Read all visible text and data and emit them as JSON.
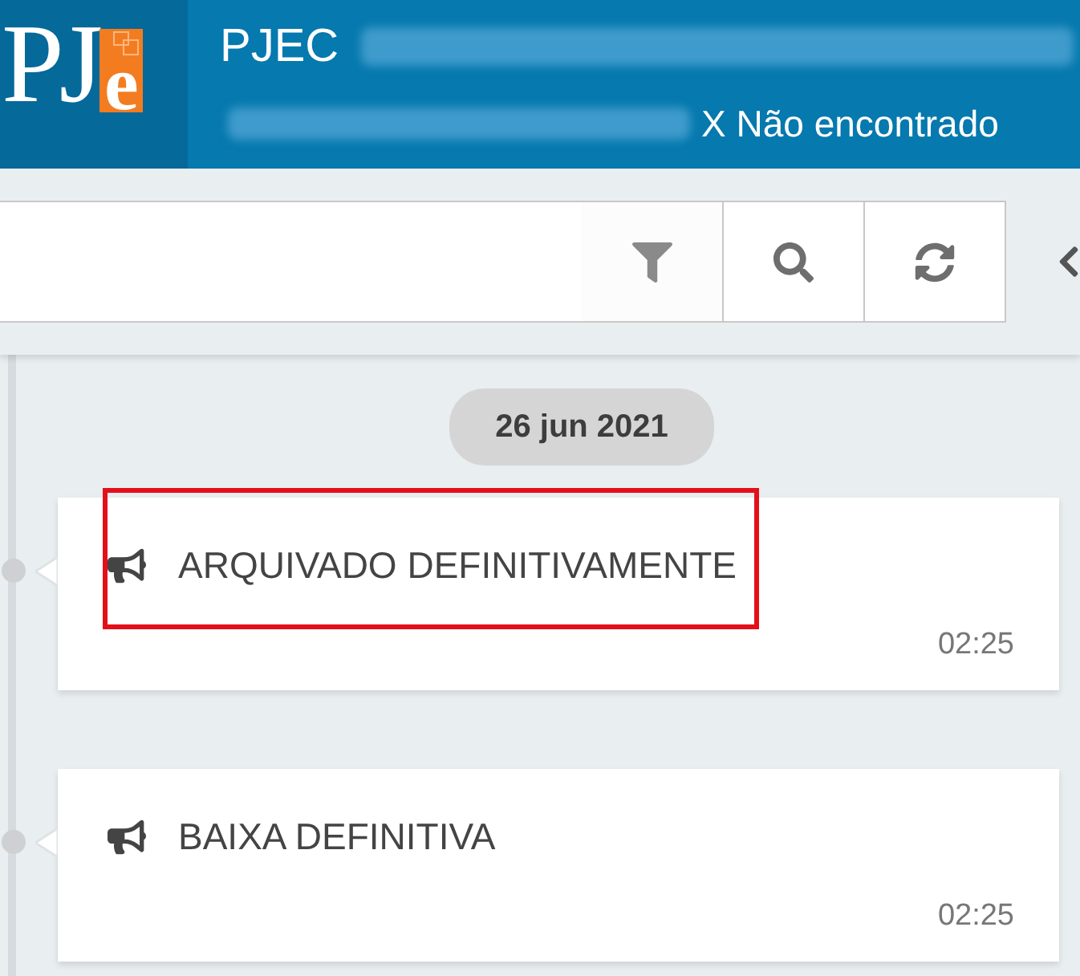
{
  "header": {
    "logo": {
      "text": "PJ",
      "accent": "e"
    },
    "title": "PJEC",
    "status": "X Não encontrado"
  },
  "toolbar": {
    "buttons": [
      {
        "kind": "filter"
      },
      {
        "kind": "search"
      },
      {
        "kind": "refresh"
      }
    ],
    "collapse": {
      "kind": "chevron-left"
    }
  },
  "timeline": {
    "date": "26 jun 2021",
    "events": [
      {
        "title": "ARQUIVADO DEFINITIVAMENTE",
        "time": "02:25",
        "highlighted": true
      },
      {
        "title": "BAIXA DEFINITIVA",
        "time": "02:25",
        "highlighted": false
      }
    ]
  }
}
